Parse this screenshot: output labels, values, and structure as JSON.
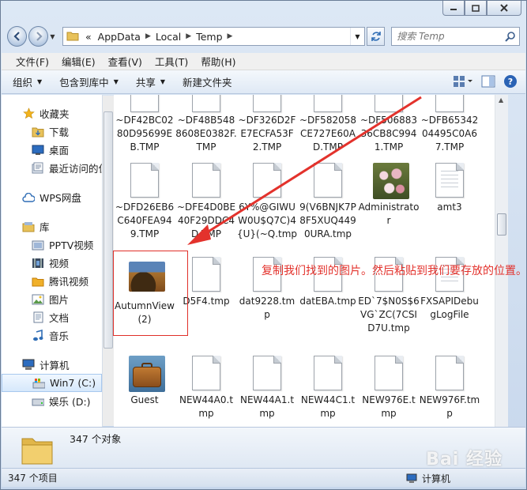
{
  "window": {
    "caption_buttons": [
      "minimize",
      "maximize",
      "close"
    ]
  },
  "address": {
    "prefix": "«",
    "crumbs": [
      "AppData",
      "Local",
      "Temp"
    ]
  },
  "search": {
    "placeholder": "搜索 Temp"
  },
  "menu": [
    "文件(F)",
    "编辑(E)",
    "查看(V)",
    "工具(T)",
    "帮助(H)"
  ],
  "toolbar": {
    "organize": "组织",
    "include_library": "包含到库中",
    "share": "共享",
    "new_folder": "新建文件夹"
  },
  "nav": {
    "favorites": "收藏夹",
    "favorites_items": [
      "下载",
      "桌面",
      "最近访问的位置"
    ],
    "wps": "WPS网盘",
    "library": "库",
    "library_items": [
      "PPTV视频",
      "视频",
      "腾讯视频",
      "图片",
      "文档",
      "音乐"
    ],
    "computer": "计算机",
    "computer_items": [
      "Win7 (C:)",
      "娱乐 (D:)"
    ]
  },
  "files": [
    {
      "name": "~DF42BC0280D95699EB.TMP",
      "kind": "doc"
    },
    {
      "name": "~DF48B5488608E0382F.TMP",
      "kind": "doc"
    },
    {
      "name": "~DF326D2FE7ECFA53F2.TMP",
      "kind": "doc"
    },
    {
      "name": "~DF582058CE727E60AD.TMP",
      "kind": "doc"
    },
    {
      "name": "~DF50688336CB8C9941.TMP",
      "kind": "doc"
    },
    {
      "name": "~DFB6534204495C0A67.TMP",
      "kind": "doc"
    },
    {
      "name": "~DFD26EB6C640FEA949.TMP",
      "kind": "doc"
    },
    {
      "name": "~DFE4D0BE40F29DDC4D.TMP",
      "kind": "doc"
    },
    {
      "name": "6Y%@GIWUW0U$Q7C)4{U}(~Q.tmp",
      "kind": "doc"
    },
    {
      "name": "9(V6BNJK7P8F5XUQ4490URA.tmp",
      "kind": "doc"
    },
    {
      "name": "Administrator",
      "kind": "flowers"
    },
    {
      "name": "amt3",
      "kind": "lines"
    },
    {
      "name": "AutumnView (2)",
      "kind": "autumn"
    },
    {
      "name": "D5F4.tmp",
      "kind": "doc"
    },
    {
      "name": "dat9228.tmp",
      "kind": "doc"
    },
    {
      "name": "datEBA.tmp",
      "kind": "doc"
    },
    {
      "name": "ED`7$N0S$6VG`ZC(7CSID7U.tmp",
      "kind": "doc"
    },
    {
      "name": "FXSAPIDebugLogFile",
      "kind": "lines"
    },
    {
      "name": "Guest",
      "kind": "suitcase"
    },
    {
      "name": "NEW44A0.tmp",
      "kind": "doc"
    },
    {
      "name": "NEW44A1.tmp",
      "kind": "doc"
    },
    {
      "name": "NEW44C1.tmp",
      "kind": "doc"
    },
    {
      "name": "NEW976E.tmp",
      "kind": "doc"
    },
    {
      "name": "NEW976F.tmp",
      "kind": "doc"
    }
  ],
  "annotation": "复制我们找到的图片。然后粘贴到我们要存放的位置。",
  "details": {
    "count": "347 个对象"
  },
  "status": {
    "left": "347 个项目",
    "right": "计算机"
  },
  "watermark": "Bai 经验",
  "colors": {
    "annotation": "#e3322c",
    "selection": "#d6e8fb"
  }
}
